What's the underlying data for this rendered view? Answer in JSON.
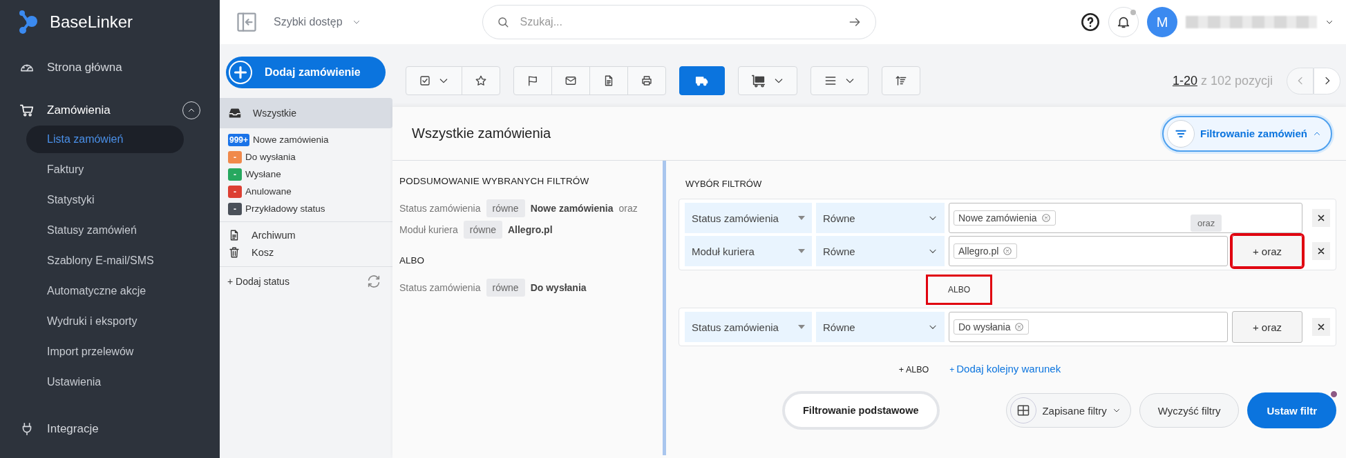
{
  "logo": "BaseLinker",
  "nav": [
    {
      "label": "Strona główna",
      "kind": "section"
    },
    {
      "label": "Zamówienia",
      "kind": "section",
      "expanded": true,
      "children": [
        {
          "label": "Lista zamówień",
          "selected": true
        },
        {
          "label": "Faktury",
          "selected": false
        },
        {
          "label": "Statystyki",
          "selected": false
        },
        {
          "label": "Statusy zamówień",
          "selected": false
        },
        {
          "label": "Szablony E-mail/SMS",
          "selected": false
        },
        {
          "label": "Automatyczne akcje",
          "selected": false
        },
        {
          "label": "Wydruki i eksporty",
          "selected": false
        },
        {
          "label": "Import przelewów",
          "selected": false
        },
        {
          "label": "Ustawienia",
          "selected": false
        }
      ]
    },
    {
      "label": "Integracje",
      "kind": "section"
    }
  ],
  "topbar": {
    "quick_access": "Szybki dostęp",
    "search": {
      "placeholder": "Szukaj..."
    },
    "avatar": "M"
  },
  "add_order_button": "Dodaj zamówienie",
  "views": [
    {
      "label": "Wszystkie",
      "selected": true
    }
  ],
  "statuses": [
    {
      "badge": "999+",
      "label": "Nowe zamówienia",
      "color": "#1a73e8",
      "selected": false
    },
    {
      "badge": "-",
      "label": "Do wysłania",
      "color": "#f0894b",
      "selected": false
    },
    {
      "badge": "-",
      "label": "Wysłane",
      "color": "#27a85f",
      "selected": false
    },
    {
      "badge": "-",
      "label": "Anulowane",
      "color": "#dc3f33",
      "selected": false
    },
    {
      "badge": "-",
      "label": "Przykładowy status",
      "color": "#4a5059",
      "selected": false
    }
  ],
  "folders": [
    {
      "label": "Archiwum",
      "selected": false
    },
    {
      "label": "Kosz",
      "selected": false
    }
  ],
  "add_status": "+ Dodaj status",
  "toolbar_groups": [
    [
      {
        "selected": false,
        "dropdown": true
      },
      {
        "selected": false,
        "dropdown": false
      }
    ],
    [
      {
        "selected": false,
        "dropdown": false
      },
      {
        "selected": false,
        "dropdown": false
      },
      {
        "selected": false,
        "dropdown": false
      },
      {
        "selected": false,
        "dropdown": false
      }
    ],
    [
      {
        "selected": true,
        "dropdown": false
      }
    ],
    [
      {
        "selected": false,
        "dropdown": true
      }
    ],
    [
      {
        "selected": false,
        "dropdown": true
      }
    ],
    [
      {
        "selected": false,
        "dropdown": false
      }
    ]
  ],
  "pagination": {
    "range": "1-20",
    "total": "z 102 pozycji"
  },
  "title": "Wszystkie zamówienia",
  "filter_toggle": {
    "label": "Filtrowanie zamówień",
    "expanded": true
  },
  "summary": {
    "title": "PODSUMOWANIE WYBRANYCH FILTRÓW",
    "groups": [
      {
        "lines": [
          {
            "field": "Status zamówienia",
            "operator": "równe",
            "value": "Nowe zamówienia",
            "joiner": "oraz"
          },
          {
            "field": "Moduł kuriera",
            "operator": "równe",
            "value": "Allegro.pl"
          }
        ]
      },
      {
        "separator": "ALBO",
        "lines": [
          {
            "field": "Status zamówienia",
            "operator": "równe",
            "value": "Do wysłania"
          }
        ]
      }
    ]
  },
  "filters": {
    "title": "WYBÓR FILTRÓW",
    "groups": [
      {
        "conditions": [
          {
            "field": "Status zamówienia",
            "operator": "Równe",
            "tags": [
              "Nowe zamówienia"
            ]
          },
          {
            "field": "Moduł kuriera",
            "operator": "Równe",
            "tags": [
              "Allegro.pl"
            ]
          }
        ],
        "and_button": {
          "label": "+ oraz",
          "highlighted": true,
          "tooltip": "oraz"
        }
      },
      {
        "separator": {
          "label": "ALBO",
          "highlighted": true
        },
        "conditions": [
          {
            "field": "Status zamówienia",
            "operator": "Równe",
            "tags": [
              "Do wysłania"
            ]
          }
        ],
        "and_button": {
          "label": "+ oraz",
          "highlighted": false
        }
      }
    ],
    "add_or": "+ ALBO",
    "add_condition": {
      "plus": "+",
      "label": "Dodaj kolejny warunek"
    }
  },
  "buttons": {
    "basic": "Filtrowanie podstawowe",
    "saved": "Zapisane filtry",
    "clear": "Wyczyść filtry",
    "apply": "Ustaw filtr"
  }
}
